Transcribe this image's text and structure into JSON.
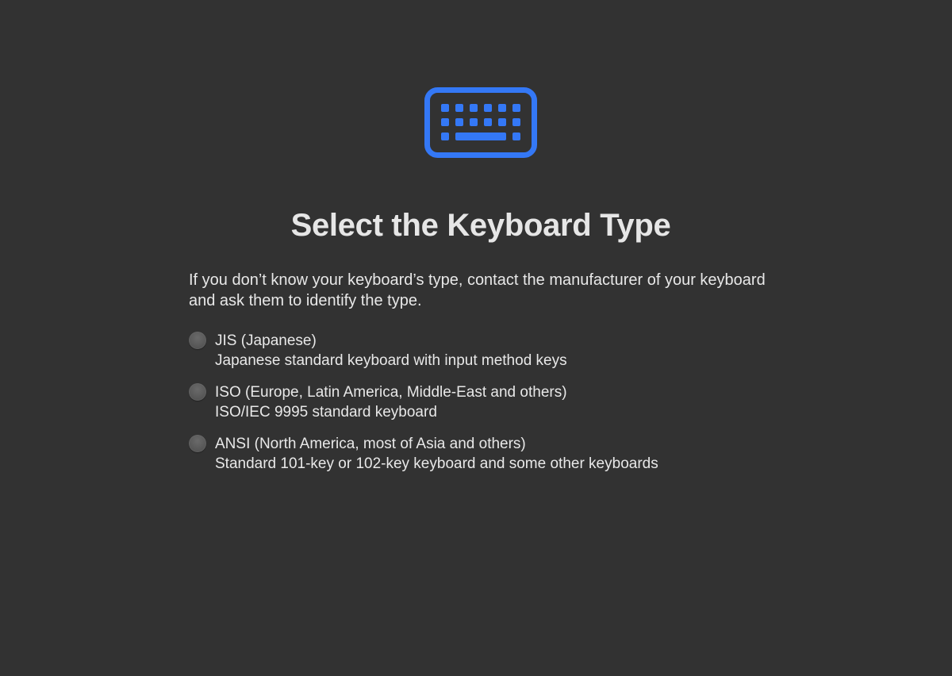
{
  "icon": {
    "name": "keyboard-icon",
    "color": "#3478F6"
  },
  "title": "Select the Keyboard Type",
  "description": "If you don’t know your keyboard’s type, contact the manufacturer of your keyboard and ask them to identify the type.",
  "options": [
    {
      "label": "JIS (Japanese)",
      "detail": "Japanese standard keyboard with input method keys",
      "selected": false
    },
    {
      "label": "ISO (Europe, Latin America, Middle-East and others)",
      "detail": "ISO/IEC 9995 standard keyboard",
      "selected": false
    },
    {
      "label": "ANSI (North America, most of Asia and others)",
      "detail": "Standard 101-key or 102-key keyboard and some other keyboards",
      "selected": false
    }
  ]
}
